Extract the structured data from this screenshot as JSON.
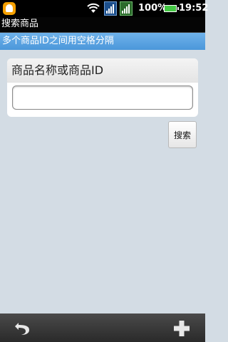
{
  "status_bar": {
    "battery": "100%",
    "time": "19:52"
  },
  "title_bar": {
    "title": "搜索商品"
  },
  "hint_bar": {
    "text": "多个商品ID之间用空格分隔"
  },
  "form": {
    "label": "商品名称或商品ID",
    "input_value": "",
    "search_button": "搜索"
  },
  "bottom_bar": {
    "icons": [
      "back-icon",
      "add-icon"
    ]
  }
}
